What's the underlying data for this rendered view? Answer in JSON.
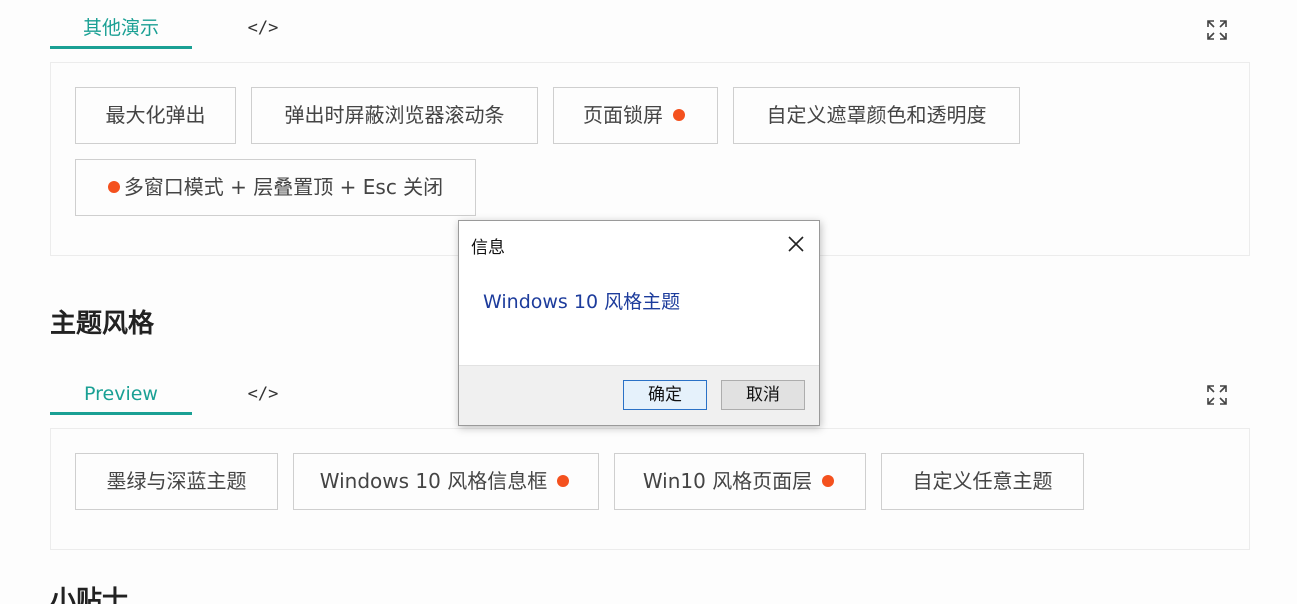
{
  "section1": {
    "tab_active": "其他演示",
    "tab_code": "</>",
    "buttons": [
      "最大化弹出",
      "弹出时屏蔽浏览器滚动条",
      "页面锁屏",
      "自定义遮罩颜色和透明度",
      "多窗口模式 + 层叠置顶 + Esc 关闭"
    ]
  },
  "section2": {
    "heading": "主题风格",
    "tab_active": "Preview",
    "tab_code": "</>",
    "buttons": [
      "墨绿与深蓝主题",
      "Windows 10 风格信息框",
      "Win10 风格页面层",
      "自定义任意主题"
    ]
  },
  "section3": {
    "heading": "小贴士"
  },
  "dialog": {
    "title": "信息",
    "message": "Windows 10 风格主题",
    "ok_label": "确定",
    "cancel_label": "取消"
  },
  "colors": {
    "accent": "#1aa094",
    "dot": "#f4511e",
    "dialog_text": "#1d3c9c"
  },
  "icons": {
    "fullscreen": "fullscreen-icon",
    "close": "close-icon",
    "new_dot": "dot-indicator"
  }
}
